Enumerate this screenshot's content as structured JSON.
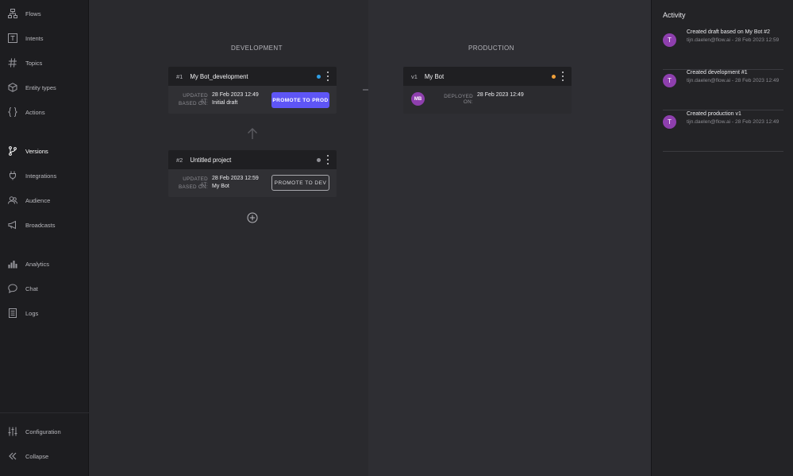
{
  "sidebar": {
    "items": [
      {
        "label": "Flows",
        "icon": "flows-icon"
      },
      {
        "label": "Intents",
        "icon": "intents-icon"
      },
      {
        "label": "Topics",
        "icon": "hash-icon"
      },
      {
        "label": "Entity types",
        "icon": "cube-icon"
      },
      {
        "label": "Actions",
        "icon": "braces-icon"
      },
      {
        "label": "Versions",
        "icon": "branch-icon"
      },
      {
        "label": "Integrations",
        "icon": "plug-icon"
      },
      {
        "label": "Audience",
        "icon": "users-icon"
      },
      {
        "label": "Broadcasts",
        "icon": "megaphone-icon"
      },
      {
        "label": "Analytics",
        "icon": "bar-chart-icon"
      },
      {
        "label": "Chat",
        "icon": "chat-bubble-icon"
      },
      {
        "label": "Logs",
        "icon": "logs-icon"
      }
    ],
    "active": "Versions",
    "bottom": [
      {
        "label": "Configuration",
        "icon": "sliders-icon"
      },
      {
        "label": "Collapse",
        "icon": "double-chevron-left-icon"
      }
    ]
  },
  "development": {
    "title": "DEVELOPMENT",
    "cards": [
      {
        "num": "#1",
        "name": "My Bot_development",
        "status_color": "#2f9fe6",
        "updated_label": "UPDATED AT:",
        "updated_value": "28 Feb 2023 12:49",
        "based_label": "BASED ON:",
        "based_value": "Initial draft",
        "button": "PROMOTE TO PROD"
      },
      {
        "num": "#2",
        "name": "Untitled project",
        "status_color": "#8f8f95",
        "updated_label": "UPDATED AT:",
        "updated_value": "28 Feb 2023 12:59",
        "based_label": "BASED ON:",
        "based_value": "My Bot",
        "button": "PROMOTE TO DEV"
      }
    ]
  },
  "production": {
    "title": "PRODUCTION",
    "card": {
      "num": "v1",
      "name": "My Bot",
      "status_color": "#f0a03a",
      "avatar": "MB",
      "deployed_label": "DEPLOYED ON:",
      "deployed_value": "28 Feb 2023 12:49"
    }
  },
  "activity": {
    "title": "Activity",
    "items": [
      {
        "avatar": "T",
        "title": "Created draft based on My Bot #2",
        "meta": "tijn.daelen@flow.ai - 28 Feb 2023 12:59"
      },
      {
        "avatar": "T",
        "title": "Created development #1",
        "meta": "tijn.daelen@flow.ai - 28 Feb 2023 12:49"
      },
      {
        "avatar": "T",
        "title": "Created production v1",
        "meta": "tijn.daelen@flow.ai - 28 Feb 2023 12:49"
      }
    ]
  },
  "colors": {
    "accent": "#5e55f6",
    "avatar": "#8e3fae"
  }
}
